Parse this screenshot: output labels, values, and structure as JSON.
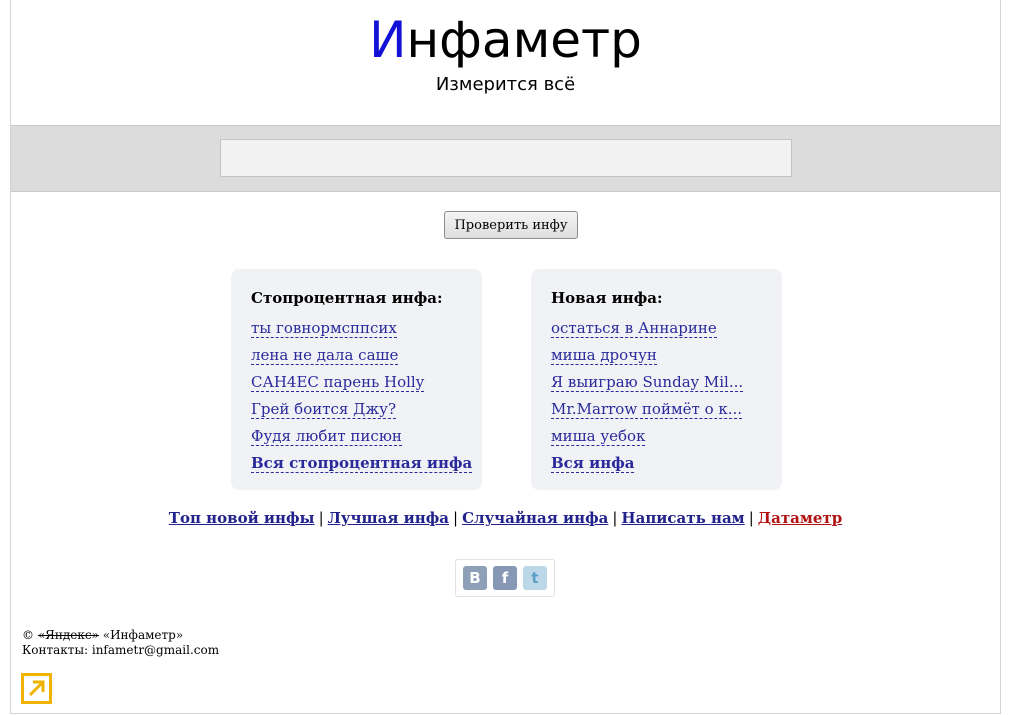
{
  "header": {
    "logo_first_letter": "И",
    "logo_rest": "нфаметр",
    "tagline": "Измерится всё"
  },
  "search": {
    "value": "",
    "placeholder": ""
  },
  "check_button": "Проверить инфу",
  "panel_left": {
    "title": "Стопроцентная инфа:",
    "items": [
      "ты говнормсппсих",
      "лена не дала саше",
      "САН4ЕС парень Holly",
      "Грей боится Джу?",
      "Фудя любит писюн"
    ],
    "all_link": "Вся стопроцентная инфа"
  },
  "panel_right": {
    "title": "Новая инфа:",
    "items": [
      "остаться в Аннарине",
      "миша дрочун",
      "Я выиграю Sunday Mil...",
      "Mr.Marrow поймёт о к...",
      "миша уебок"
    ],
    "all_link": "Вся инфа"
  },
  "footer_links": [
    "Топ новой инфы",
    "Лучшая инфа",
    "Случайная инфа",
    "Написать нам",
    "Датаметр"
  ],
  "separator": "|",
  "social": {
    "vk": "В",
    "fb": "f",
    "tw": "t"
  },
  "copyright": {
    "symbol": "©",
    "struck": "«Яндекс»",
    "name": "«Инфаметр»",
    "contacts": "Контакты: infametr@gmail.com"
  },
  "colors": {
    "logo_accent": "#1212d6",
    "link": "#2a2a9c",
    "datametr_link": "#b01212",
    "panel_bg": "#f1f2f5",
    "search_band": "#dcdcdc",
    "corner_icon": "#f0b400"
  }
}
